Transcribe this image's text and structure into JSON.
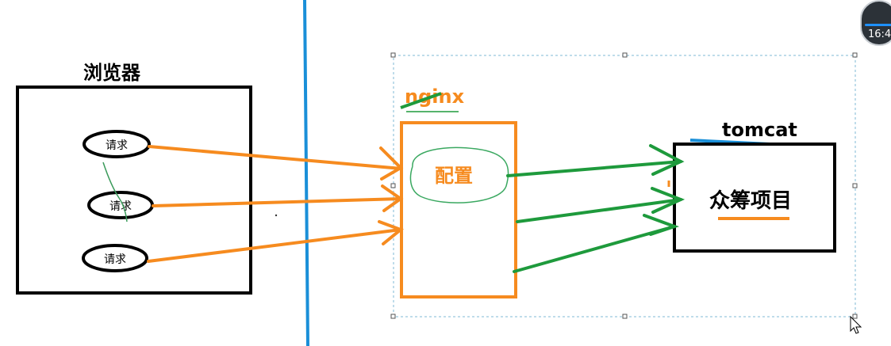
{
  "browser": {
    "title": "浏览器",
    "requests": [
      "请求",
      "请求",
      "请求"
    ]
  },
  "nginx": {
    "title": "nginx",
    "config_label": "配置"
  },
  "tomcat": {
    "title": "tomcat",
    "project_label": "众筹项目"
  },
  "overlay": {
    "clock_text": "16:4"
  },
  "colors": {
    "box_stroke": "#000000",
    "divider": "#1a8fd8",
    "orange": "#f68b1f",
    "green": "#1e9a3c",
    "selection": "#7fb8d6"
  }
}
